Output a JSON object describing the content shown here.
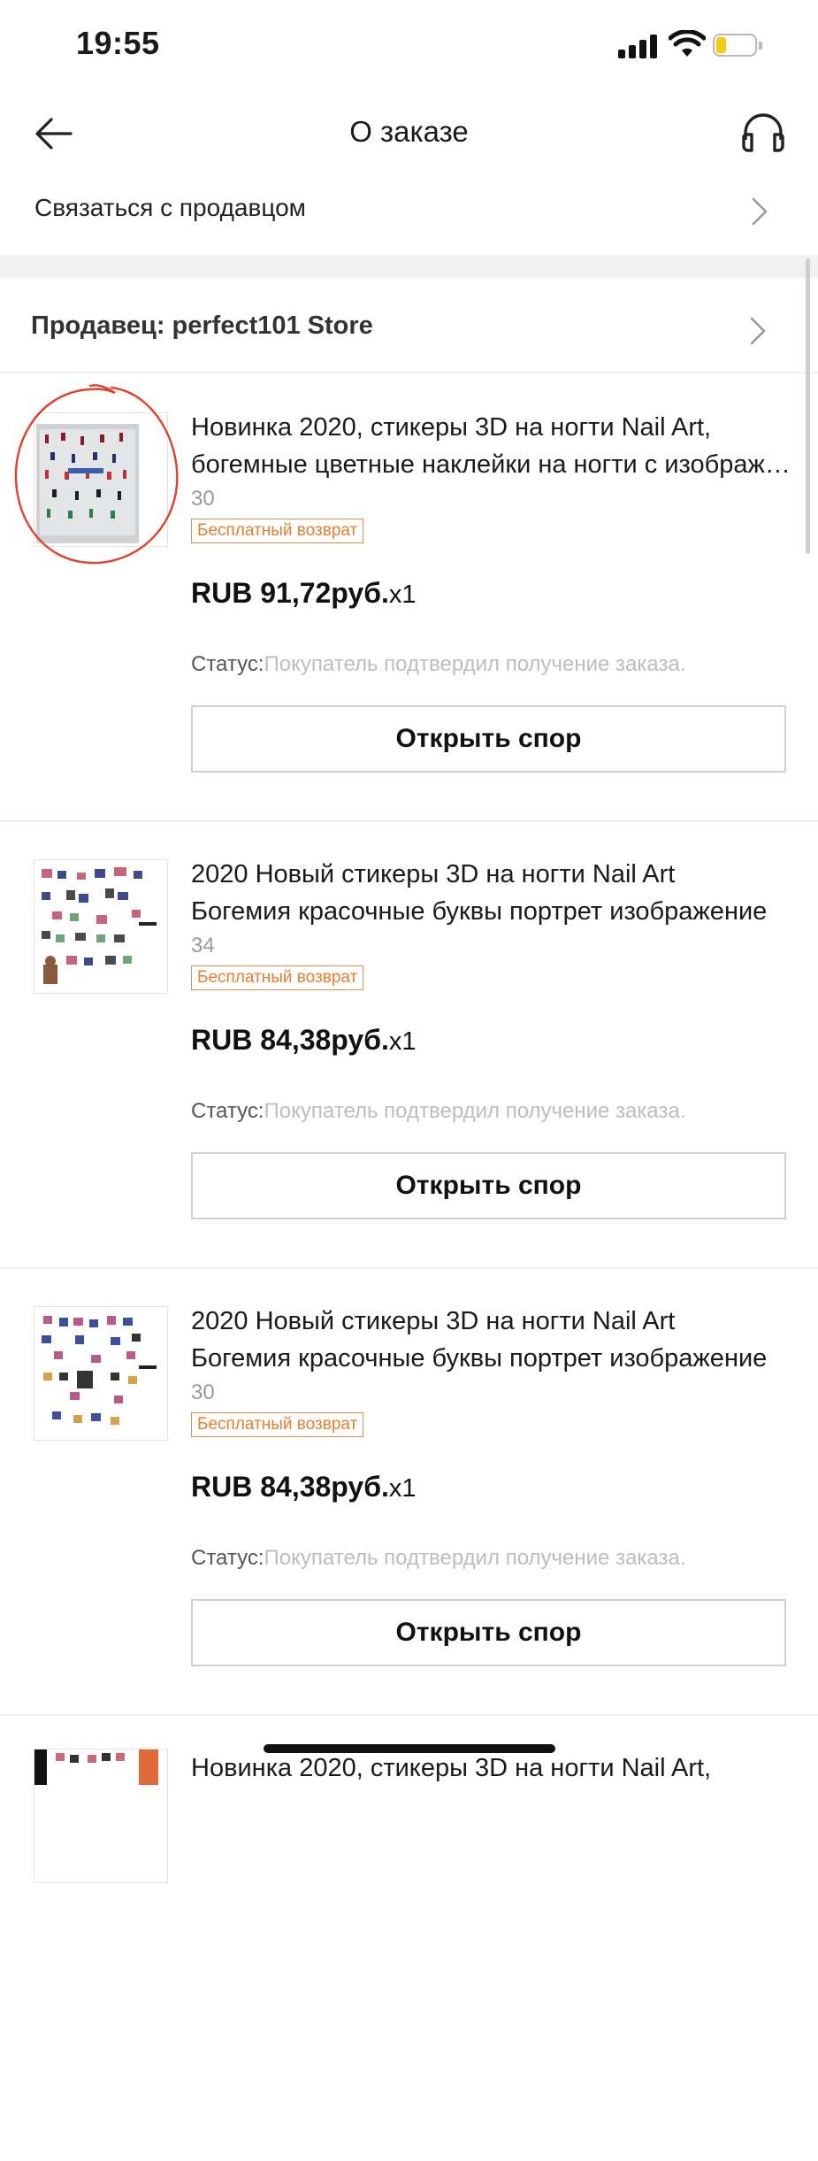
{
  "status_bar": {
    "time": "19:55"
  },
  "header": {
    "title": "О заказе"
  },
  "contact_row": {
    "label": "Связаться с продавцом"
  },
  "seller": {
    "label": "Продавец: perfect101 Store"
  },
  "items": [
    {
      "title_line1": "Новинка 2020, стикеры 3D на ногти Nail Art,",
      "title_line2": "богемные цветные наклейки на ногти с изображением",
      "sku": "30",
      "badge": "Бесплатный возврат",
      "price": "RUB 91,72руб.",
      "qty": "x1",
      "status_label": "Статус:",
      "status_value": "Покупатель подтвердил получение заказа.",
      "dispute_label": "Открыть спор"
    },
    {
      "title_line1": "2020 Новый стикеры 3D на ногти Nail Art",
      "title_line2": "Богемия красочные буквы портрет изображение",
      "sku": "34",
      "badge": "Бесплатный возврат",
      "price": "RUB 84,38руб.",
      "qty": "x1",
      "status_label": "Статус:",
      "status_value": "Покупатель подтвердил получение заказа.",
      "dispute_label": "Открыть спор"
    },
    {
      "title_line1": "2020 Новый стикеры 3D на ногти Nail Art",
      "title_line2": "Богемия красочные буквы портрет изображение",
      "sku": "30",
      "badge": "Бесплатный возврат",
      "price": "RUB 84,38руб.",
      "qty": "x1",
      "status_label": "Статус:",
      "status_value": "Покупатель подтвердил получение заказа.",
      "dispute_label": "Открыть спор"
    },
    {
      "title_line1": "Новинка 2020, стикеры 3D на ногти Nail Art,"
    }
  ],
  "colors": {
    "badge": "#e67e2e",
    "annotation_circle": "#e0412a",
    "battery_level": "#f4cc0c"
  }
}
